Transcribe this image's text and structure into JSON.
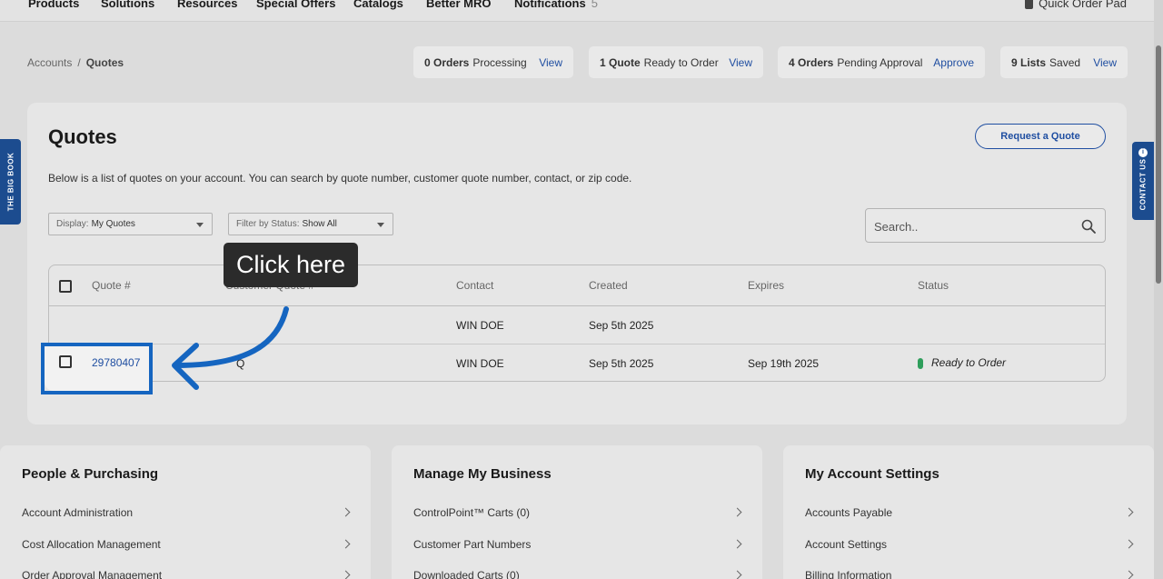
{
  "nav": {
    "items": [
      "Products",
      "Solutions",
      "Resources",
      "Special Offers",
      "Catalogs",
      "Better MRO",
      "Notifications"
    ],
    "notifications_count": "5",
    "quick_order_pad": "Quick Order Pad"
  },
  "breadcrumb": {
    "parent": "Accounts",
    "separator": "/",
    "current": "Quotes"
  },
  "status_pills": [
    {
      "count": "0 Orders",
      "text": "Processing",
      "action": "View"
    },
    {
      "count": "1 Quote",
      "text": "Ready to Order",
      "action": "View"
    },
    {
      "count": "4 Orders",
      "text": "Pending Approval",
      "action": "Approve"
    },
    {
      "count": "9 Lists",
      "text": "Saved",
      "action": "View"
    }
  ],
  "side_tabs": {
    "left": "THE BIG BOOK",
    "right": "CONTACT US",
    "info_glyph": "i"
  },
  "quotes": {
    "title": "Quotes",
    "description": "Below is a list of quotes on your account. You can search by quote number, customer quote number, contact, or zip code.",
    "request_button": "Request a Quote",
    "display_filter": {
      "label": "Display:",
      "value": "My Quotes"
    },
    "status_filter": {
      "label": "Filter by Status:",
      "value": "Show All"
    },
    "search_placeholder": "Search..",
    "table": {
      "headers": [
        "Quote #",
        "Customer Quote #",
        "Contact",
        "Created",
        "Expires",
        "Status"
      ],
      "rows": [
        {
          "quote": "",
          "customer_quote": "",
          "contact": "WIN DOE",
          "created": "Sep 5th 2025",
          "expires": "",
          "status": ""
        },
        {
          "quote": "29780407",
          "customer_quote": "Q",
          "contact": "WIN DOE",
          "created": "Sep 5th 2025",
          "expires": "Sep 19th 2025",
          "status": "Ready to Order"
        }
      ]
    }
  },
  "annotation": {
    "tooltip": "Click here",
    "highlight_color": "#1565c0",
    "status_color": "#2e9e5b"
  },
  "cards": [
    {
      "title": "People & Purchasing",
      "items": [
        "Account Administration",
        "Cost Allocation Management",
        "Order Approval Management"
      ]
    },
    {
      "title": "Manage My Business",
      "items": [
        "ControlPoint™ Carts (0)",
        "Customer Part Numbers",
        "Downloaded Carts (0)"
      ]
    },
    {
      "title": "My Account Settings",
      "items": [
        "Accounts Payable",
        "Account Settings",
        "Billing Information"
      ]
    }
  ]
}
